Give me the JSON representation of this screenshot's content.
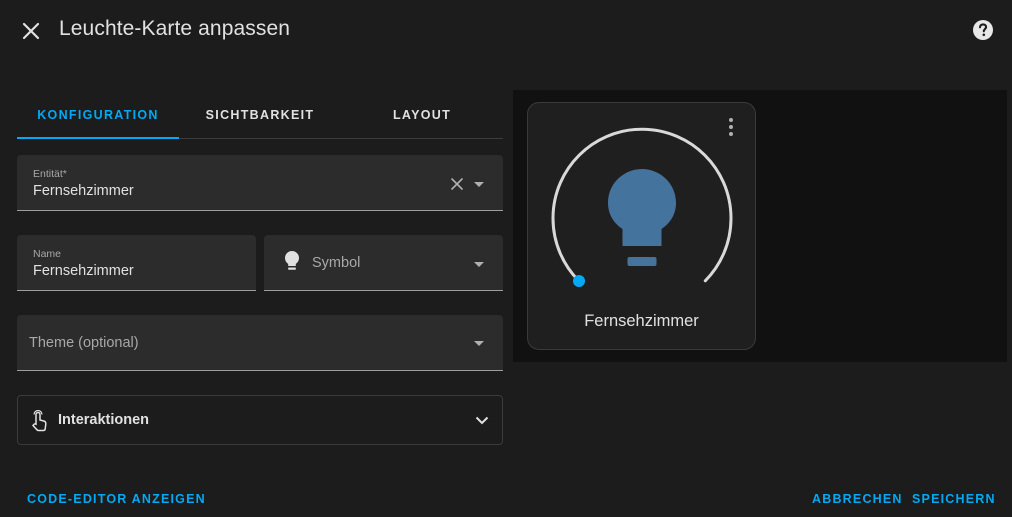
{
  "header": {
    "title": "Leuchte-Karte anpassen",
    "close_icon": "close-icon",
    "help_icon": "help-circle-icon"
  },
  "tabs": [
    {
      "label": "KONFIGURATION",
      "active": true
    },
    {
      "label": "SICHTBARKEIT",
      "active": false
    },
    {
      "label": "LAYOUT",
      "active": false
    }
  ],
  "form": {
    "entity": {
      "label": "Entität*",
      "value": "Fernsehzimmer"
    },
    "name": {
      "label": "Name",
      "value": "Fernsehzimmer"
    },
    "symbol": {
      "placeholder": "Symbol",
      "icon": "lightbulb-icon"
    },
    "theme": {
      "placeholder": "Theme (optional)"
    },
    "interactions": {
      "label": "Interaktionen",
      "icon": "gesture-tap-icon"
    }
  },
  "preview": {
    "card_name": "Fernsehzimmer",
    "brightness_fraction": 0,
    "accent_color": "#03a9f4",
    "bulb_color": "#44739e"
  },
  "footer": {
    "code_editor": "CODE-EDITOR ANZEIGEN",
    "cancel": "ABBRECHEN",
    "save": "SPEICHERN"
  },
  "colors": {
    "accent": "#03a9f4",
    "background": "#1c1c1c",
    "field_bg": "#2c2c2c"
  }
}
